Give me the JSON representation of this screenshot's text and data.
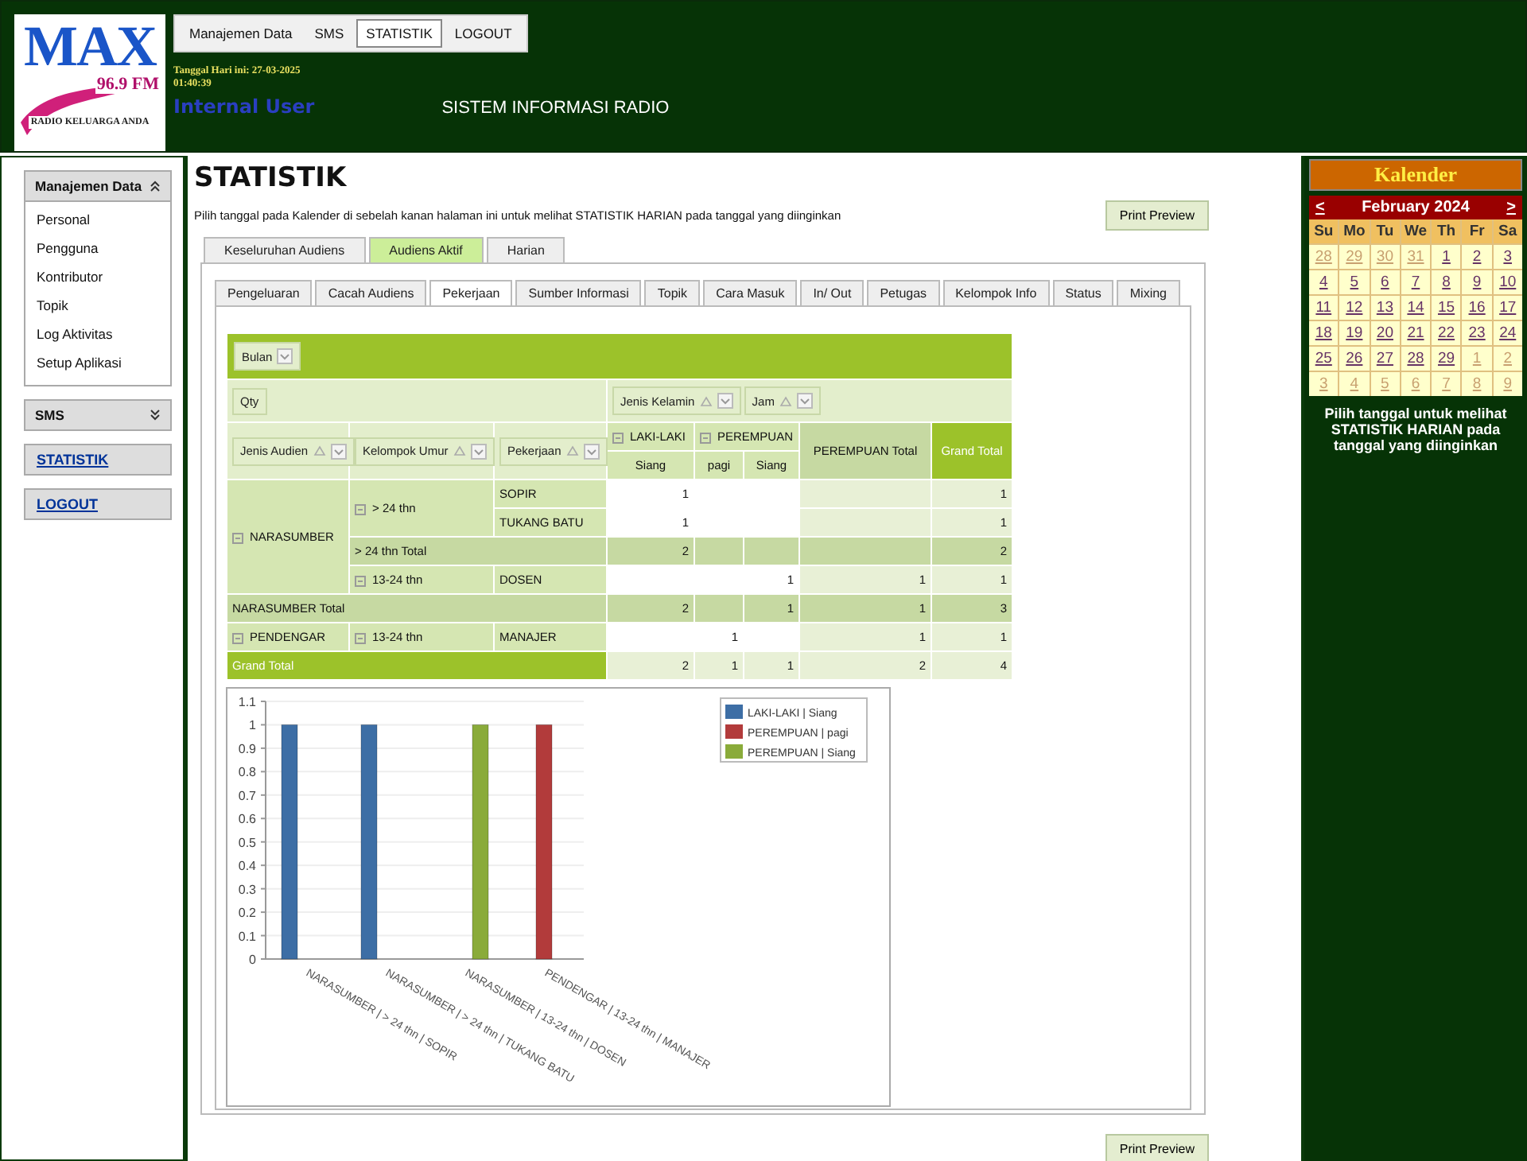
{
  "header": {
    "logo": {
      "brand": "MAX",
      "frequency": "96.9 FM",
      "tagline": "RADIO KELUARGA ANDA"
    },
    "menu": [
      {
        "label": "Manajemen Data",
        "selected": false
      },
      {
        "label": "SMS",
        "selected": false
      },
      {
        "label": "STATISTIK",
        "selected": true
      },
      {
        "label": "LOGOUT",
        "selected": false
      }
    ],
    "date": "Tanggal Hari ini: 27-03-2025 01:40:39",
    "user": "Internal User",
    "app_title": "SISTEM INFORMASI RADIO"
  },
  "sidebar": [
    {
      "kind": "panel",
      "title": "Manajemen Data",
      "expanded": true,
      "items": [
        "Personal",
        "Pengguna",
        "Kontributor",
        "Topik",
        "Log Aktivitas",
        "Setup Aplikasi"
      ]
    },
    {
      "kind": "panel",
      "title": "SMS",
      "expanded": false
    },
    {
      "kind": "link",
      "title": "STATISTIK"
    },
    {
      "kind": "link",
      "title": "LOGOUT"
    }
  ],
  "page": {
    "title": "STATISTIK",
    "description": "Pilih tanggal pada Kalender di sebelah kanan halaman ini untuk melihat STATISTIK HARIAN pada tanggal yang diinginkan",
    "print_button": "Print Preview",
    "tabs": [
      {
        "label": "Keseluruhan Audiens",
        "selected": false
      },
      {
        "label": "Audiens Aktif",
        "selected": true
      },
      {
        "label": "Harian",
        "selected": false
      }
    ],
    "subtabs": [
      {
        "label": "Pengeluaran",
        "selected": false
      },
      {
        "label": "Cacah Audiens",
        "selected": false
      },
      {
        "label": "Pekerjaan",
        "selected": true
      },
      {
        "label": "Sumber Informasi",
        "selected": false
      },
      {
        "label": "Topik",
        "selected": false
      },
      {
        "label": "Cara Masuk",
        "selected": false
      },
      {
        "label": "In/ Out",
        "selected": false
      },
      {
        "label": "Petugas",
        "selected": false
      },
      {
        "label": "Kelompok Info",
        "selected": false
      },
      {
        "label": "Status",
        "selected": false
      },
      {
        "label": "Mixing",
        "selected": false
      }
    ],
    "pivot": {
      "filter_field": "Bulan",
      "data_field": "Qty",
      "column_fields": [
        "Jenis Kelamin",
        "Jam"
      ],
      "row_fields": [
        "Jenis Audien",
        "Kelompok Umur",
        "Pekerjaan"
      ],
      "column_groups": [
        {
          "label": "LAKI-LAKI",
          "children": [
            "Siang"
          ]
        },
        {
          "label": "PEREMPUAN",
          "children": [
            "pagi",
            "Siang"
          ]
        }
      ],
      "total_columns": [
        {
          "label": "PEREMPUAN Total",
          "kind": "subtotal"
        },
        {
          "label": "Grand Total",
          "kind": "grand"
        }
      ],
      "row_groups": [
        {
          "label": "NARASUMBER",
          "children": [
            {
              "label": "> 24 thn",
              "children": [
                {
                  "label": "SOPIR",
                  "values": [
                    {
                      "kind": "value",
                      "value": "1"
                    },
                    {
                      "kind": "blank"
                    },
                    {
                      "kind": "blank"
                    },
                    {
                      "kind": "blank"
                    },
                    {
                      "kind": "value",
                      "value": "1"
                    }
                  ]
                },
                {
                  "label": "TUKANG BATU",
                  "values": [
                    {
                      "kind": "value",
                      "value": "1"
                    },
                    {
                      "kind": "blank"
                    },
                    {
                      "kind": "blank"
                    },
                    {
                      "kind": "blank"
                    },
                    {
                      "kind": "value",
                      "value": "1"
                    }
                  ]
                }
              ],
              "total": {
                "label": "> 24 thn Total",
                "values": [
                  {
                    "kind": "value",
                    "value": "2"
                  },
                  {
                    "kind": "blank"
                  },
                  {
                    "kind": "blank"
                  },
                  {
                    "kind": "blank"
                  },
                  {
                    "kind": "value",
                    "value": "2"
                  }
                ]
              }
            },
            {
              "label": "13-24 thn",
              "children": [
                {
                  "label": "DOSEN",
                  "values": [
                    {
                      "kind": "blank"
                    },
                    {
                      "kind": "blank"
                    },
                    {
                      "kind": "value",
                      "value": "1"
                    },
                    {
                      "kind": "value",
                      "value": "1"
                    },
                    {
                      "kind": "value",
                      "value": "1"
                    }
                  ]
                }
              ]
            }
          ],
          "total": {
            "label": "NARASUMBER Total",
            "values": [
              {
                "kind": "value",
                "value": "2"
              },
              {
                "kind": "blank"
              },
              {
                "kind": "value",
                "value": "1"
              },
              {
                "kind": "value",
                "value": "1"
              },
              {
                "kind": "value",
                "value": "3"
              }
            ]
          }
        },
        {
          "label": "PENDENGAR",
          "children": [
            {
              "label": "13-24 thn",
              "children": [
                {
                  "label": "MANAJER",
                  "values": [
                    {
                      "kind": "blank"
                    },
                    {
                      "kind": "value",
                      "value": "1"
                    },
                    {
                      "kind": "blank"
                    },
                    {
                      "kind": "value",
                      "value": "1"
                    },
                    {
                      "kind": "value",
                      "value": "1"
                    }
                  ]
                }
              ]
            }
          ]
        }
      ],
      "grand_total": {
        "label": "Grand Total",
        "values": [
          {
            "kind": "value",
            "value": "2"
          },
          {
            "kind": "value",
            "value": "1"
          },
          {
            "kind": "value",
            "value": "1"
          },
          {
            "kind": "value",
            "value": "2"
          },
          {
            "kind": "value",
            "value": "4"
          }
        ]
      }
    },
    "chart": {
      "chart_data": {
        "type": "bar",
        "categories": [
          "NARASUMBER | > 24 thn | SOPIR",
          "NARASUMBER | > 24 thn | TUKANG BATU",
          "NARASUMBER | 13-24 thn | DOSEN",
          "PENDENGAR | 13-24 thn | MANAJER"
        ],
        "series": [
          {
            "name": "LAKI-LAKI | Siang",
            "color": "#3d6ea5",
            "values": [
              1,
              1,
              null,
              null
            ]
          },
          {
            "name": "PEREMPUAN | pagi",
            "color": "#b23b3b",
            "values": [
              null,
              null,
              null,
              1
            ]
          },
          {
            "name": "PEREMPUAN | Siang",
            "color": "#8aab3a",
            "values": [
              null,
              null,
              1,
              null
            ]
          }
        ],
        "ylim": [
          0,
          1.1
        ],
        "yticks": [
          0,
          0.1,
          0.2,
          0.3,
          0.4,
          0.5,
          0.6,
          0.7,
          0.8,
          0.9,
          1,
          1.1
        ],
        "grid": true,
        "legend": true
      }
    },
    "bottom_print_button": "Print Preview"
  },
  "calendar": {
    "title": "Kalender",
    "prev": "<",
    "month": "February 2024",
    "next": ">",
    "weekdays": [
      "Su",
      "Mo",
      "Tu",
      "We",
      "Th",
      "Fr",
      "Sa"
    ],
    "weeks": [
      [
        {
          "day": "28",
          "muted": true
        },
        {
          "day": "29",
          "muted": true
        },
        {
          "day": "30",
          "muted": true
        },
        {
          "day": "31",
          "muted": true
        },
        {
          "day": "1",
          "muted": false
        },
        {
          "day": "2",
          "muted": false
        },
        {
          "day": "3",
          "muted": false
        }
      ],
      [
        {
          "day": "4",
          "muted": false
        },
        {
          "day": "5",
          "muted": false
        },
        {
          "day": "6",
          "muted": false
        },
        {
          "day": "7",
          "muted": false
        },
        {
          "day": "8",
          "muted": false
        },
        {
          "day": "9",
          "muted": false
        },
        {
          "day": "10",
          "muted": false
        }
      ],
      [
        {
          "day": "11",
          "muted": false
        },
        {
          "day": "12",
          "muted": false
        },
        {
          "day": "13",
          "muted": false
        },
        {
          "day": "14",
          "muted": false
        },
        {
          "day": "15",
          "muted": false
        },
        {
          "day": "16",
          "muted": false
        },
        {
          "day": "17",
          "muted": false
        }
      ],
      [
        {
          "day": "18",
          "muted": false
        },
        {
          "day": "19",
          "muted": false
        },
        {
          "day": "20",
          "muted": false
        },
        {
          "day": "21",
          "muted": false
        },
        {
          "day": "22",
          "muted": false
        },
        {
          "day": "23",
          "muted": false
        },
        {
          "day": "24",
          "muted": false
        }
      ],
      [
        {
          "day": "25",
          "muted": false
        },
        {
          "day": "26",
          "muted": false
        },
        {
          "day": "27",
          "muted": false
        },
        {
          "day": "28",
          "muted": false
        },
        {
          "day": "29",
          "muted": false
        },
        {
          "day": "1",
          "muted": true
        },
        {
          "day": "2",
          "muted": true
        }
      ],
      [
        {
          "day": "3",
          "muted": true
        },
        {
          "day": "4",
          "muted": true
        },
        {
          "day": "5",
          "muted": true
        },
        {
          "day": "6",
          "muted": true
        },
        {
          "day": "7",
          "muted": true
        },
        {
          "day": "8",
          "muted": true
        },
        {
          "day": "9",
          "muted": true
        }
      ]
    ],
    "note": "Pilih tanggal untuk melihat STATISTIK HARIAN pada tanggal yang diinginkan"
  }
}
